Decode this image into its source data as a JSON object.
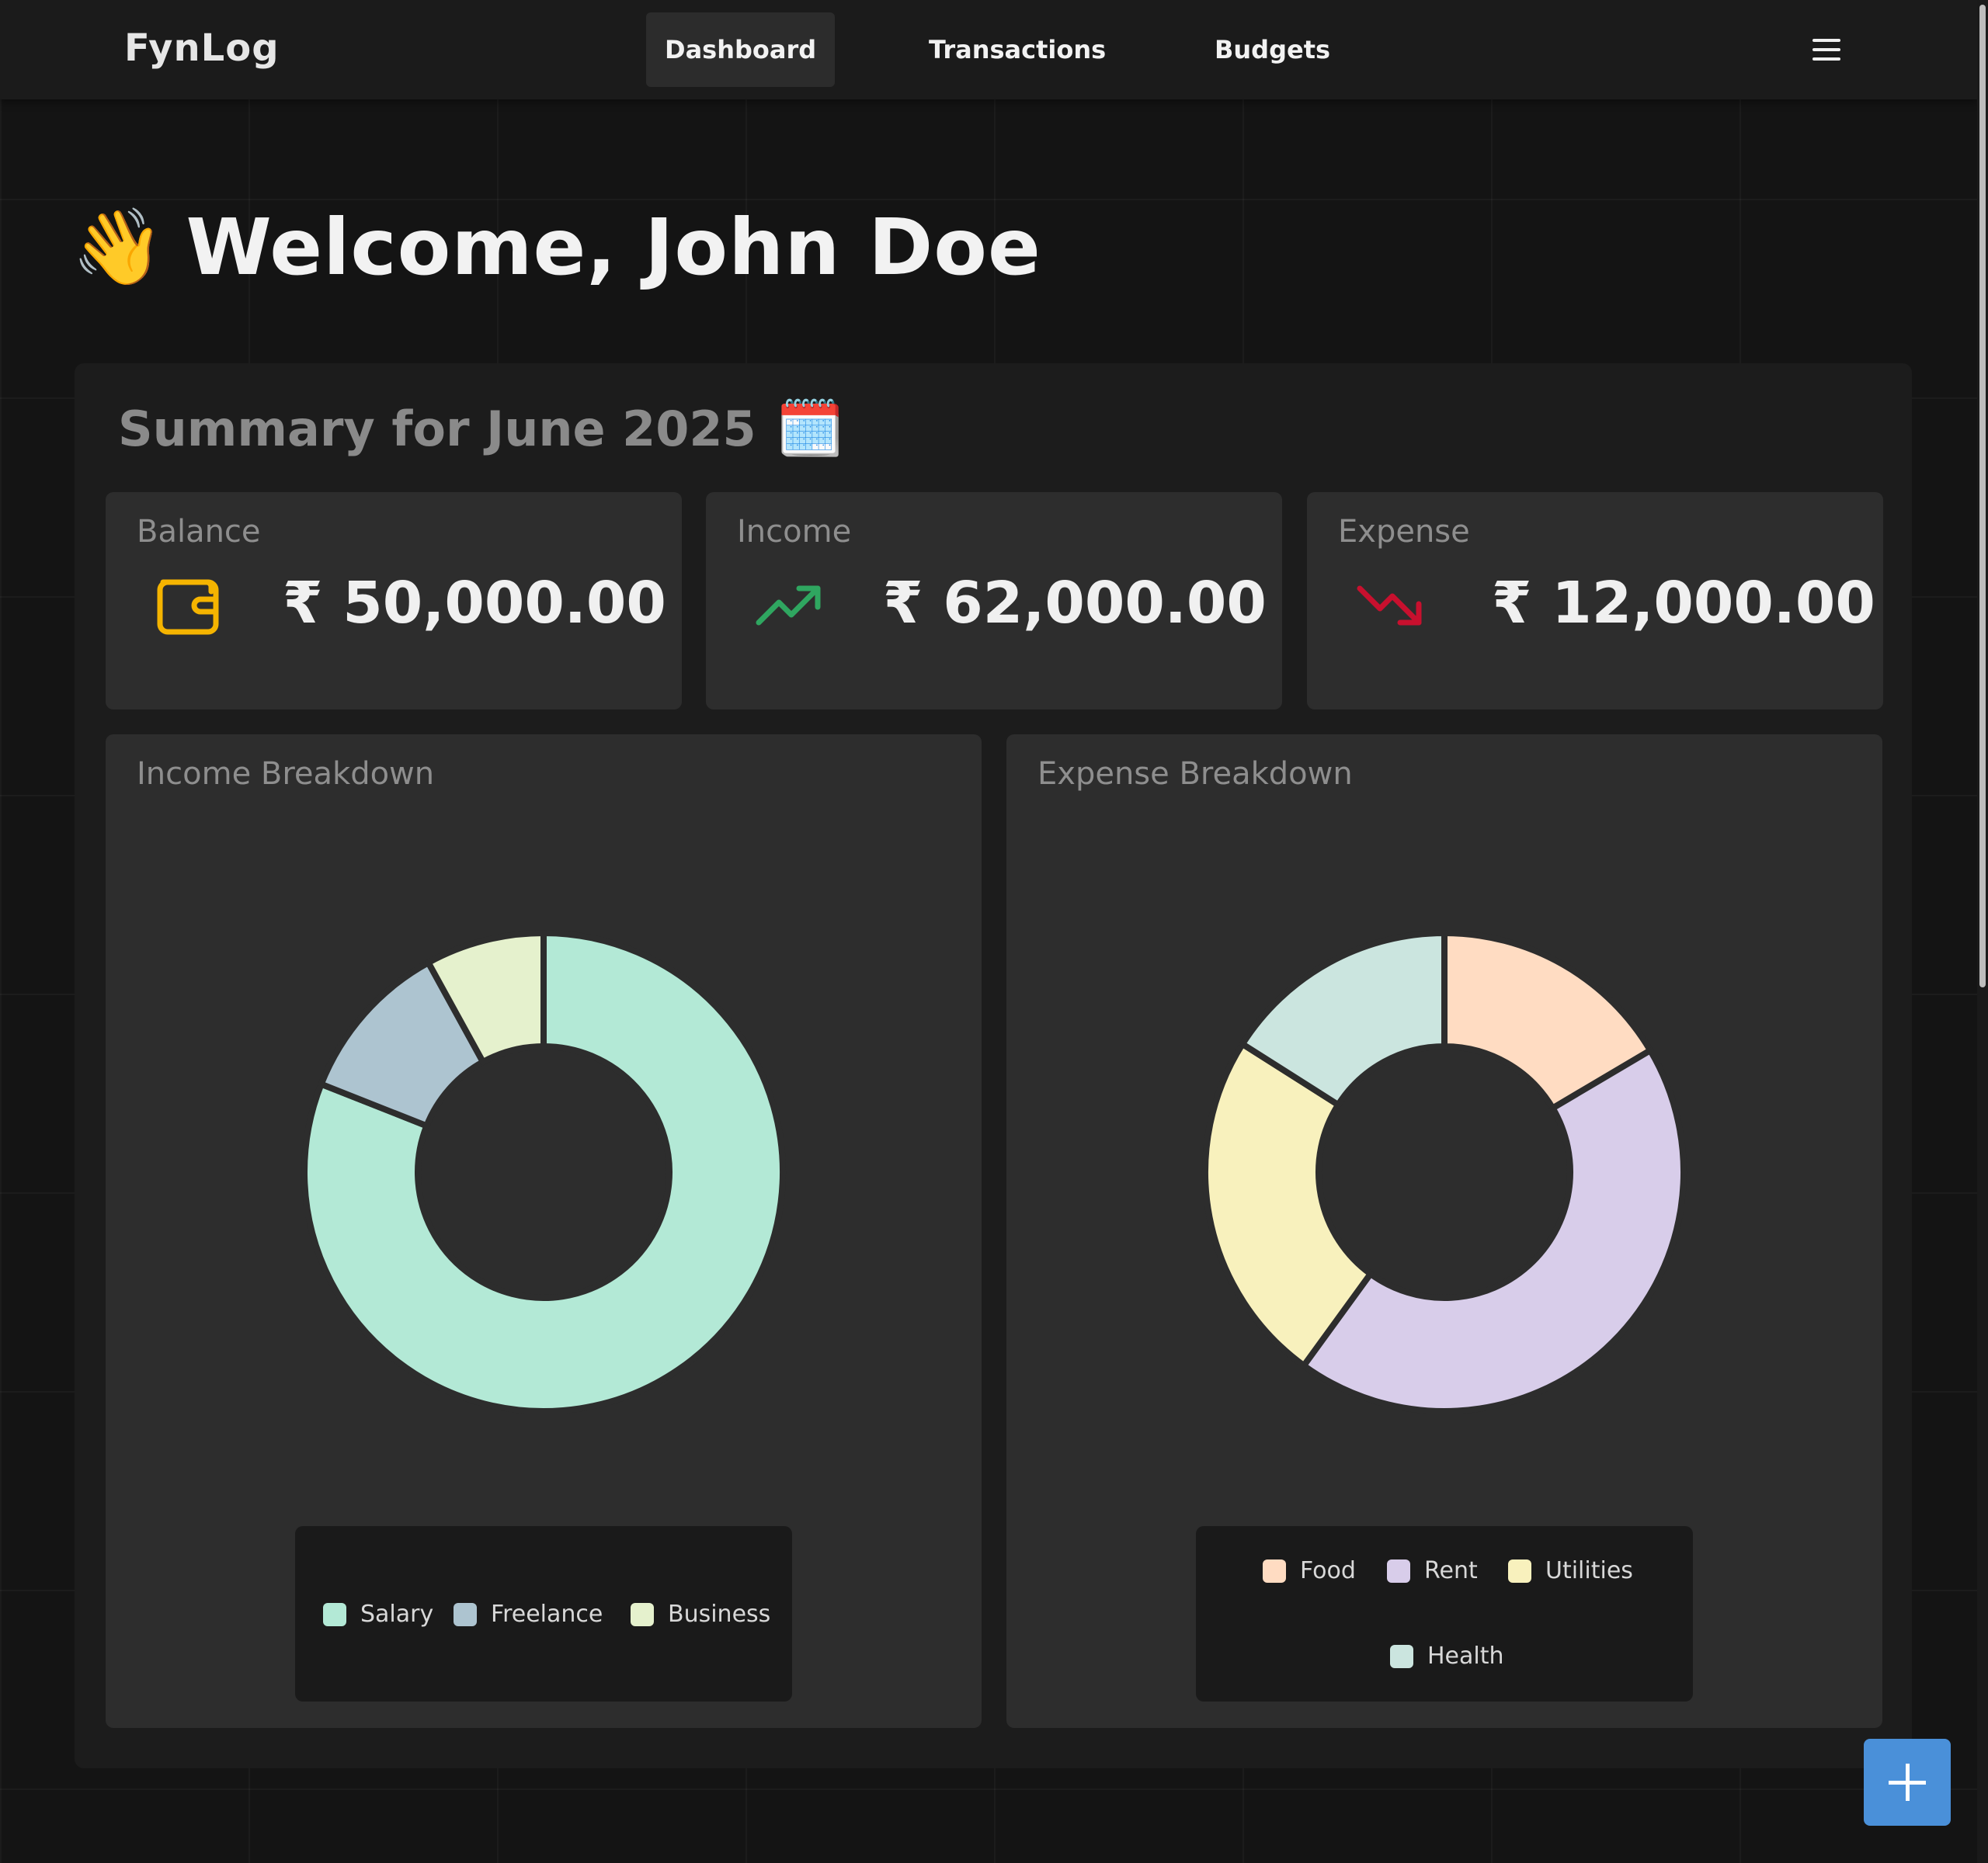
{
  "app": {
    "brand": "FynLog"
  },
  "nav": {
    "tabs": [
      {
        "label": "Dashboard",
        "active": true
      },
      {
        "label": "Transactions",
        "active": false
      },
      {
        "label": "Budgets",
        "active": false
      }
    ],
    "menu_icon": "hamburger-menu-icon"
  },
  "welcome": {
    "emoji": "👋",
    "title": "Welcome, John Doe"
  },
  "summary": {
    "title": "Summary for June 2025",
    "emoji": "🗓️",
    "cards": [
      {
        "label": "Balance",
        "value": "₹ 50,000.00",
        "icon": "wallet-icon",
        "color": "#f5b400"
      },
      {
        "label": "Income",
        "value": "₹ 62,000.00",
        "icon": "trending-up-icon",
        "color": "#2fa660"
      },
      {
        "label": "Expense",
        "value": "₹ 12,000.00",
        "icon": "trending-down-icon",
        "color": "#c8102e"
      }
    ]
  },
  "chart_data": [
    {
      "type": "pie",
      "title": "Income Breakdown",
      "categories": [
        "Salary",
        "Freelance",
        "Business"
      ],
      "values": [
        81,
        11,
        8
      ],
      "colors": [
        "#b3e9d6",
        "#adc4d0",
        "#e5f1cd"
      ]
    },
    {
      "type": "pie",
      "title": "Expense Breakdown",
      "categories": [
        "Food",
        "Rent",
        "Utilities",
        "Health"
      ],
      "values": [
        16.5,
        43.5,
        24,
        16
      ],
      "colors": [
        "#ffdcc2",
        "#d8cdea",
        "#f8f1bd",
        "#cbe5df"
      ]
    }
  ],
  "fab": {
    "icon": "plus-icon"
  }
}
